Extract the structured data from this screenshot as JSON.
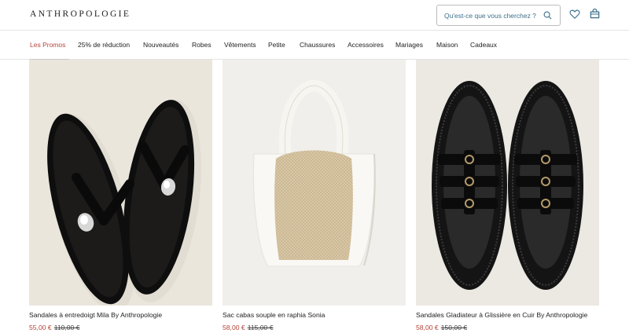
{
  "header": {
    "logo": "ANTHROPOLOGIE",
    "search_placeholder": "Qu'est-ce que vous cherchez ?"
  },
  "nav": {
    "items": [
      "Les Promos",
      "25% de réduction",
      "Nouveautés",
      "Robes",
      "Vêtements",
      "Petite",
      "Chaussures",
      "Accessoires",
      "Mariages",
      "Maison",
      "Cadeaux"
    ],
    "active": "Les Promos"
  },
  "products": [
    {
      "title": "Sandales à entredoigt Mila By Anthropologie",
      "sale_price": "55,00 €",
      "original_price": "110,00 €"
    },
    {
      "title": "Sac cabas souple en raphia Sonia",
      "sale_price": "58,00 €",
      "original_price": "115,00 €"
    },
    {
      "title": "Sandales Gladiateur à Glissière en Cuir By Anthropologie",
      "sale_price": "58,00 €",
      "original_price": "150,00 €"
    }
  ],
  "colors": {
    "sale": "#b5443a",
    "search_text": "#3f6f8c",
    "icon": "#3a6e8c"
  }
}
